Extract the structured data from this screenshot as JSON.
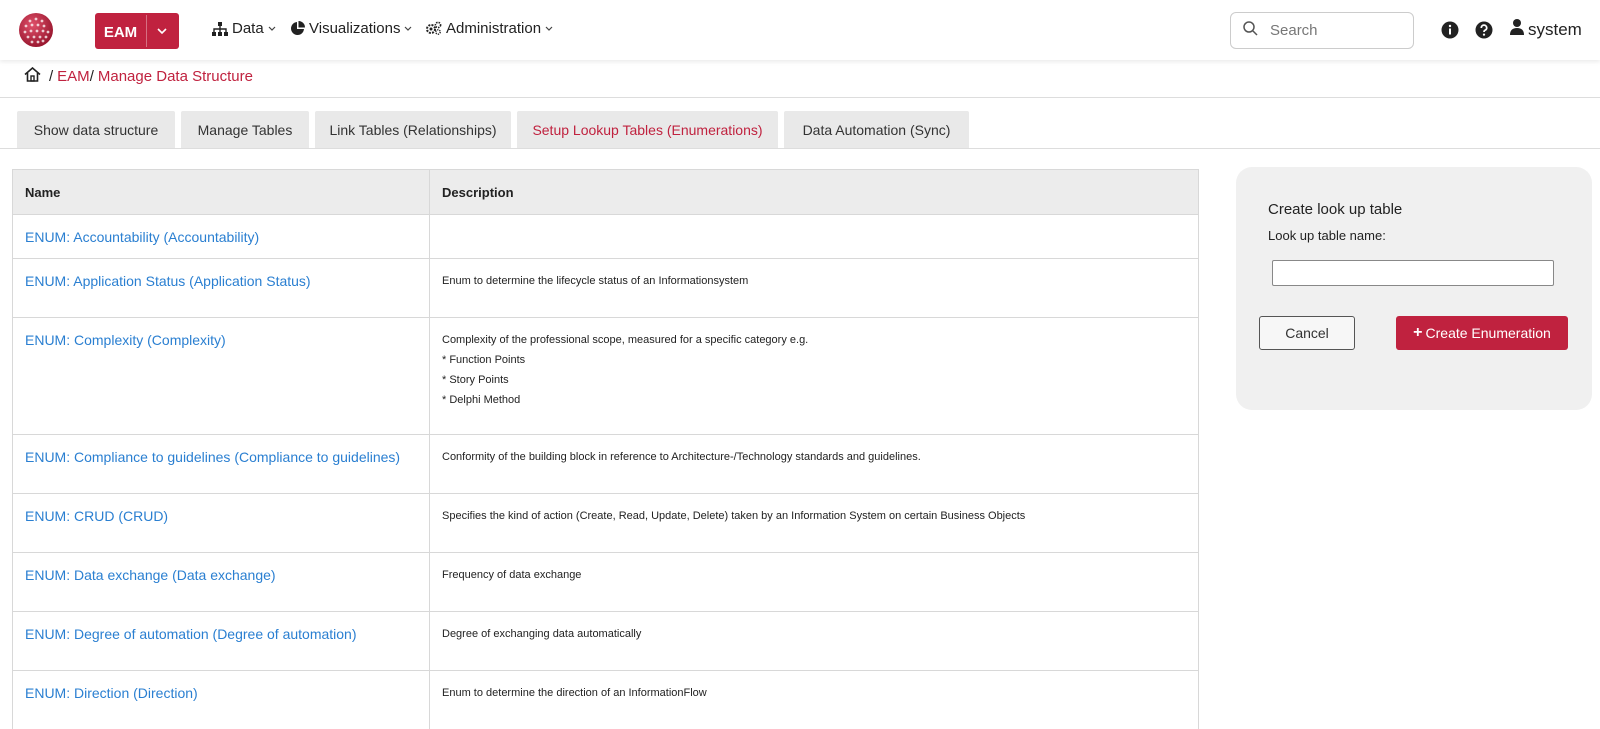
{
  "navbar": {
    "app_name": "EAM",
    "menus": [
      {
        "label": "Data",
        "icon": "sitemap-icon"
      },
      {
        "label": "Visualizations",
        "icon": "pie-chart-icon"
      },
      {
        "label": "Administration",
        "icon": "cogs-icon"
      }
    ],
    "search_placeholder": "Search",
    "user_name": "system",
    "brand_color": "#c0223f"
  },
  "breadcrumb": {
    "items": [
      "EAM",
      "Manage Data Structure"
    ]
  },
  "tabs": [
    {
      "label": "Show data structure",
      "active": false
    },
    {
      "label": "Manage Tables",
      "active": false
    },
    {
      "label": "Link Tables (Relationships)",
      "active": false
    },
    {
      "label": "Setup Lookup Tables (Enumerations)",
      "active": true
    },
    {
      "label": "Data Automation (Sync)",
      "active": false
    }
  ],
  "table": {
    "headers": [
      "Name",
      "Description"
    ],
    "rows": [
      {
        "name": "ENUM: Accountability (Accountability)",
        "description": []
      },
      {
        "name": "ENUM: Application Status (Application Status)",
        "description": [
          "Enum to determine the lifecycle status of an Informationsystem"
        ]
      },
      {
        "name": "ENUM: Complexity (Complexity)",
        "description": [
          "Complexity of the professional scope, measured for a specific category e.g.",
          "* Function Points",
          "* Story Points",
          "* Delphi Method"
        ]
      },
      {
        "name": "ENUM: Compliance to guidelines (Compliance to guidelines)",
        "description": [
          "Conformity of the building block in reference to Architecture-/Technology standards and guidelines."
        ]
      },
      {
        "name": "ENUM: CRUD (CRUD)",
        "description": [
          "Specifies the kind of action (Create, Read, Update, Delete) taken by an Information System on certain Business Objects"
        ]
      },
      {
        "name": "ENUM: Data exchange (Data exchange)",
        "description": [
          "Frequency of data exchange"
        ]
      },
      {
        "name": "ENUM: Degree of automation (Degree of automation)",
        "description": [
          "Degree of exchanging data automatically"
        ]
      },
      {
        "name": "ENUM: Direction (Direction)",
        "description": [
          "Enum to determine the direction of an InformationFlow"
        ]
      }
    ]
  },
  "panel": {
    "title": "Create look up table",
    "field_label": "Look up table name:",
    "field_value": "",
    "cancel_label": "Cancel",
    "create_label": "Create Enumeration"
  }
}
